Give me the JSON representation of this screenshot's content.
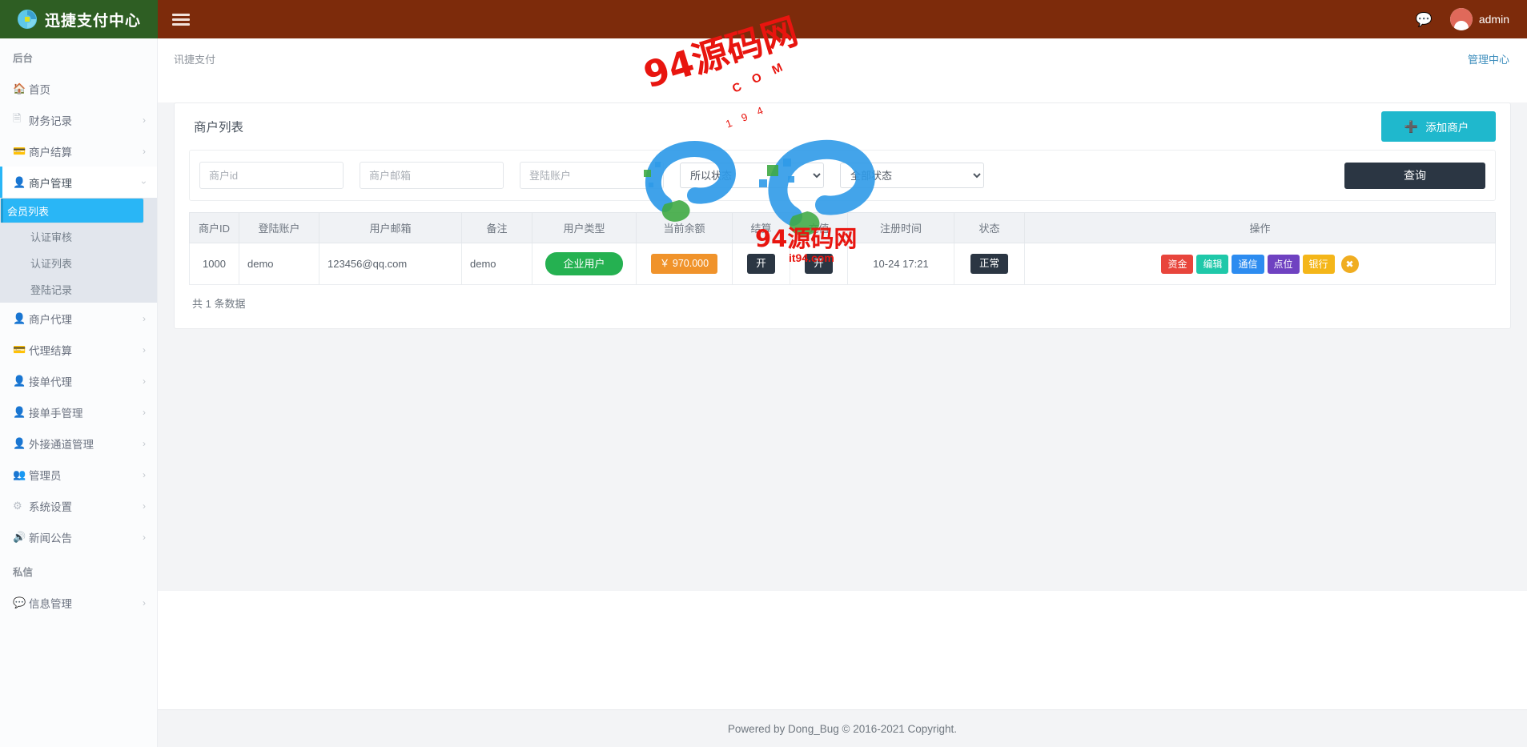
{
  "header": {
    "logo_text": "迅捷支付中心",
    "logo_icon": "swirl-logo-icon",
    "menu_icon": "hamburger-icon",
    "chat_icon": "chat-bubble-icon",
    "username": "admin"
  },
  "sidebar": {
    "section_label_1": "后台",
    "section_label_2": "私信",
    "items": [
      {
        "label": "首页",
        "icon": "home-icon",
        "arrow": ""
      },
      {
        "label": "财务记录",
        "icon": "file-icon",
        "arrow": "›"
      },
      {
        "label": "商户结算",
        "icon": "receipt-icon",
        "arrow": "›"
      },
      {
        "label": "商户管理",
        "icon": "user-icon",
        "arrow": "›"
      },
      {
        "label": "商户代理",
        "icon": "user-icon",
        "arrow": "›"
      },
      {
        "label": "代理结算",
        "icon": "receipt-icon",
        "arrow": "›"
      },
      {
        "label": "接单代理",
        "icon": "user-icon",
        "arrow": "›"
      },
      {
        "label": "接单手管理",
        "icon": "user-icon",
        "arrow": "›"
      },
      {
        "label": "外接通道管理",
        "icon": "user-icon",
        "arrow": "›"
      },
      {
        "label": "管理员",
        "icon": "users-icon",
        "arrow": "›"
      },
      {
        "label": "系统设置",
        "icon": "gear-icon",
        "arrow": "›"
      },
      {
        "label": "新闻公告",
        "icon": "megaphone-icon",
        "arrow": "›"
      }
    ],
    "submenu": [
      {
        "label": "会员列表"
      },
      {
        "label": "认证审核"
      },
      {
        "label": "认证列表"
      },
      {
        "label": "登陆记录"
      }
    ],
    "private_items": [
      {
        "label": "信息管理",
        "icon": "message-icon",
        "arrow": "›"
      }
    ]
  },
  "breadcrumb": {
    "left": "讯捷支付",
    "right": "管理中心"
  },
  "card": {
    "title": "商户列表",
    "add_button": "添加商户",
    "add_icon": "plus-icon"
  },
  "search": {
    "merchant_id_placeholder": "商户id",
    "merchant_email_placeholder": "商户邮箱",
    "login_account_placeholder": "登陆账户",
    "merchant_id_value": "",
    "merchant_email_value": "",
    "login_account_value": "",
    "select_1_value": "所以状态",
    "select_1_options": [
      "所以状态"
    ],
    "select_2_value": "全部状态",
    "select_2_options": [
      "全部状态"
    ],
    "query_button": "查询"
  },
  "table": {
    "headers": [
      "商户ID",
      "登陆账户",
      "用户邮箱",
      "备注",
      "用户类型",
      "当前余额",
      "结算",
      "充值",
      "注册时间",
      "状态",
      "操作"
    ],
    "rows": [
      {
        "merchant_id": "1000",
        "login_account": "demo",
        "email": "123456@qq.com",
        "remark": "demo",
        "user_type": "企业用户",
        "balance": "￥ 970.000",
        "settle": "开",
        "recharge": "开",
        "reg_time": "10-24 17:21",
        "status": "正常",
        "ops": [
          {
            "label": "资金",
            "color": "op-red"
          },
          {
            "label": "编辑",
            "color": "op-teal"
          },
          {
            "label": "通信",
            "color": "op-blue"
          },
          {
            "label": "点位",
            "color": "op-purple"
          },
          {
            "label": "银行",
            "color": "op-yellow"
          }
        ],
        "ops_extra_icon": "close-circle-icon"
      }
    ],
    "total_text": "共 1 条数据"
  },
  "watermark": {
    "line1": "94源码网",
    "line2": "C O M",
    "line3": "1 9 4",
    "line4": "94源码网",
    "line5": "it94.com"
  },
  "footer": {
    "text": "Powered by Dong_Bug © 2016-2021 Copyright."
  },
  "colors": {
    "header_brown": "#7d2b0b",
    "logo_green": "#2e5e23",
    "accent_cyan": "#29b6f6",
    "add_button": "#1fb8cd",
    "query_button": "#2b3643",
    "watermark_red": "#e8150f"
  }
}
